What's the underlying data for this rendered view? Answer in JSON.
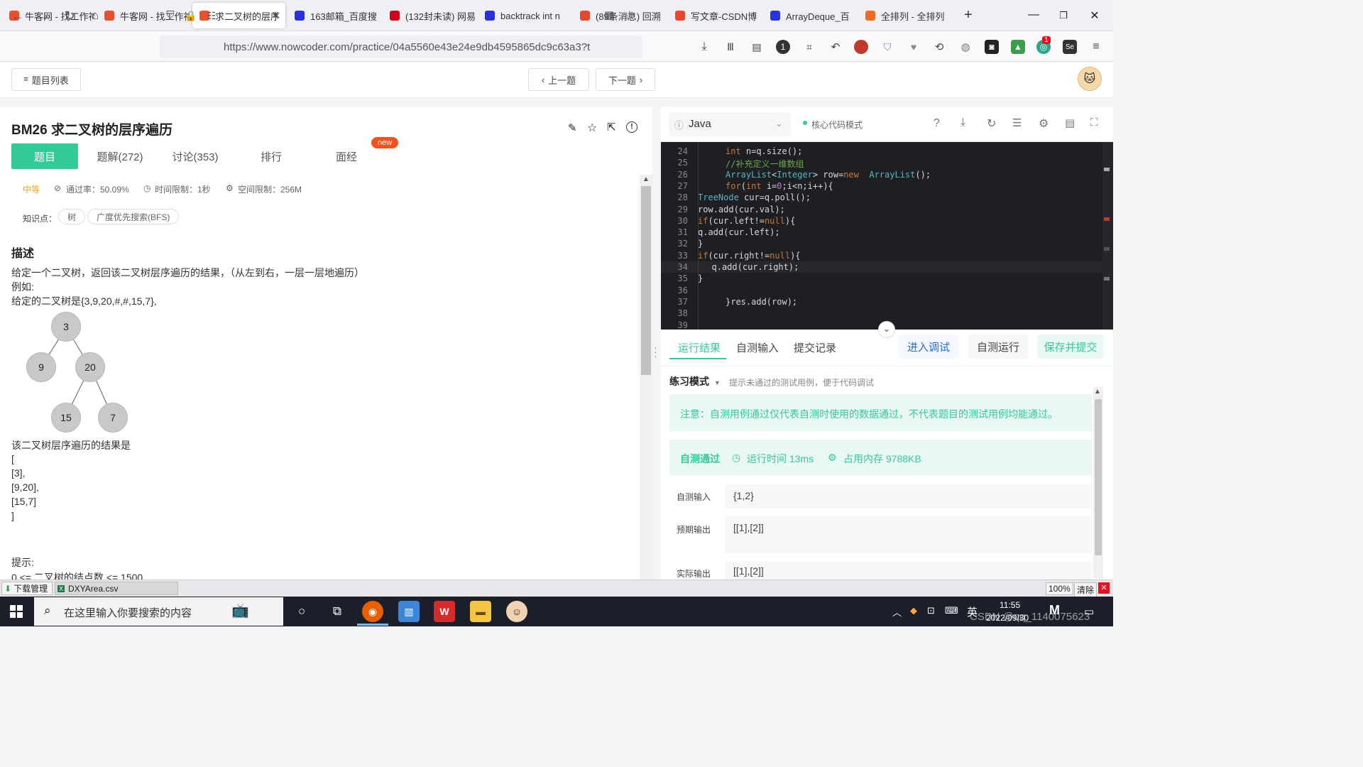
{
  "browser": {
    "tabs": [
      {
        "title": "牛客网 - 找工作神",
        "icon_color": "#e8502e",
        "icon": "nowcoder-icon"
      },
      {
        "title": "牛客网 - 找工作神",
        "icon_color": "#e8502e",
        "icon": "nowcoder-icon"
      },
      {
        "title": "求二叉树的层序",
        "icon_color": "#e8502e",
        "icon": "nowcoder-icon"
      },
      {
        "title": "163邮箱_百度搜",
        "icon_color": "#2932e1",
        "icon": "baidu-paw-icon"
      },
      {
        "title": "(132封未读) 网易",
        "icon_color": "#d0021b",
        "icon": "netease-icon"
      },
      {
        "title": "backtrack int n",
        "icon_color": "#2932e1",
        "icon": "baidu-paw-icon"
      },
      {
        "title": "(89条消息) 回溯",
        "icon_color": "#e8462e",
        "icon": "csdn-icon"
      },
      {
        "title": "写文章-CSDN博",
        "icon_color": "#e8462e",
        "icon": "csdn-icon"
      },
      {
        "title": "ArrayDeque_百",
        "icon_color": "#2932e1",
        "icon": "baidu-paw-icon"
      },
      {
        "title": "全排列 - 全排列",
        "icon_color": "#f06a24",
        "icon": "leetcode-icon"
      }
    ],
    "new_tab": "+",
    "url": "https://www.nowcoder.com/practice/04a5560e43e24e9db4595865dc9c63a3?t",
    "ext_badge": "1"
  },
  "header": {
    "problem_list": "题目列表",
    "prev": "上一题",
    "next": "下一题"
  },
  "problem": {
    "title": "BM26  求二叉树的层序遍历",
    "tabs": [
      "题目",
      "题解(272)",
      "讨论(353)",
      "排行",
      "面经"
    ],
    "new_badge": "new",
    "difficulty": "中等",
    "pass_rate": "通过率：50.09%",
    "time_limit": "时间限制：1秒",
    "space_limit": "空间限制：256M",
    "knowledge_label": "知识点：",
    "tags": [
      "树",
      "广度优先搜索(BFS)"
    ],
    "desc_heading": "描述",
    "desc": [
      "给定一个二叉树，返回该二叉树层序遍历的结果，（从左到右，一层一层地遍历）",
      "例如:",
      "给定的二叉树是{3,9,20,#,#,15,7},"
    ],
    "tree_nodes": [
      "3",
      "9",
      "20",
      "15",
      "7"
    ],
    "result_intro": "该二叉树层序遍历的结果是",
    "result_lines": [
      "[",
      "[3],",
      "[9,20],",
      "[15,7]",
      "]"
    ],
    "hint_label": "提示:",
    "hint_line": "0 <= 二叉树的结点数 <= 1500"
  },
  "editor": {
    "language": "Java",
    "mode": "核心代码模式",
    "lines": [
      {
        "n": "24",
        "indent": 2,
        "code": "int n=q.size();"
      },
      {
        "n": "25",
        "indent": 2,
        "code": "//补充定义一维数组"
      },
      {
        "n": "26",
        "indent": 2,
        "code": "ArrayList<Integer> row=new  ArrayList();"
      },
      {
        "n": "27",
        "indent": 2,
        "code": "for(int i=0;i<n;i++){"
      },
      {
        "n": "28",
        "indent": 0,
        "code": "TreeNode cur=q.poll();"
      },
      {
        "n": "29",
        "indent": 0,
        "code": "row.add(cur.val);"
      },
      {
        "n": "30",
        "indent": 0,
        "code": "if(cur.left!=null){"
      },
      {
        "n": "31",
        "indent": 0,
        "code": "q.add(cur.left);"
      },
      {
        "n": "32",
        "indent": 0,
        "code": "}"
      },
      {
        "n": "33",
        "indent": 0,
        "code": "if(cur.right!=null){"
      },
      {
        "n": "34",
        "indent": 1,
        "code": "q.add(cur.right);"
      },
      {
        "n": "35",
        "indent": 0,
        "code": "}"
      },
      {
        "n": "36",
        "indent": 0,
        "code": ""
      },
      {
        "n": "37",
        "indent": 2,
        "code": "}res.add(row);"
      },
      {
        "n": "38",
        "indent": 0,
        "code": ""
      },
      {
        "n": "39",
        "indent": 0,
        "code": ""
      }
    ]
  },
  "result_panel": {
    "tabs": [
      "运行结果",
      "自测输入",
      "提交记录"
    ],
    "debug": "进入调试",
    "self_run": "自测运行",
    "save_submit": "保存并提交",
    "practice_mode": "练习模式",
    "practice_hint": "提示未通过的测试用例，便于代码调试",
    "notice": "注意：自测用例通过仅代表自测时使用的数据通过，不代表题目的测试用例均能通过。",
    "status": "自测通过",
    "runtime": "运行时间 13ms",
    "memory": "占用内存 9788KB",
    "input_label": "自测输入",
    "input_value": "{1,2}",
    "expected_label": "预期输出",
    "expected_value": "[[1],[2]]",
    "actual_label": "实际输出",
    "actual_value": "[[1],[2]]"
  },
  "downloads": {
    "manager": "下载管理",
    "file": "DXYArea.csv",
    "zoom": "100%",
    "clear": "清除"
  },
  "taskbar": {
    "search_placeholder": "在这里输入你要搜索的内容",
    "ime": "英",
    "time": "11:55",
    "date": "2022/09/30",
    "watermark": "CSDN @qq_1140075623"
  }
}
